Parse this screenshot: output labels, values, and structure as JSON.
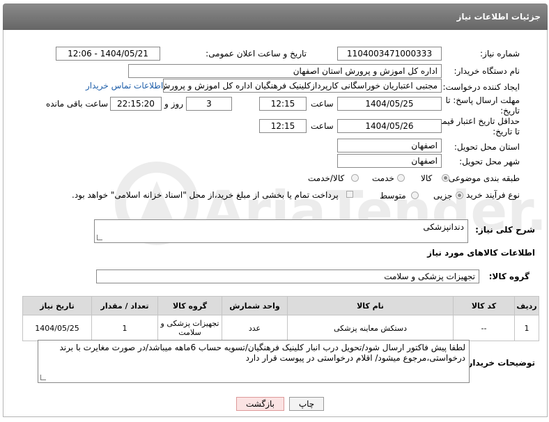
{
  "header": {
    "title": "جزئیات اطلاعات نیاز"
  },
  "form": {
    "need_number_label": "شماره نیاز:",
    "need_number": "1104003471000333",
    "announce_label": "تاریخ و ساعت اعلان عمومی:",
    "announce_value": "1404/05/21 - 12:06",
    "buyer_org_label": "نام دستگاه خریدار:",
    "buyer_org": "اداره کل اموزش و پرورش استان اصفهان",
    "requester_label": "ایجاد کننده درخواست:",
    "requester": "مجتبی اعتباریان خوراسگانی کارپردازکلینیک فرهنگیان اداره کل اموزش و پرورش ا",
    "contact_link": "اطلاعات تماس خریدار",
    "deadline_label_1": "مهلت ارسال پاسخ: تا",
    "deadline_label_2": "تاریخ:",
    "deadline_date": "1404/05/25",
    "time_label": "ساعت",
    "deadline_time": "12:15",
    "days_value": "3",
    "days_label": "روز و",
    "remaining_time": "22:15:20",
    "remaining_label": "ساعت باقی مانده",
    "validity_label_1": "حداقل تاریخ اعتبار قیمت:",
    "validity_label_2": "تا تاریخ:",
    "validity_date": "1404/05/26",
    "validity_time": "12:15",
    "province_label": "استان محل تحویل:",
    "province": "اصفهان",
    "city_label": "شهر محل تحویل:",
    "city": "اصفهان",
    "category_label": "طبقه بندی موضوعی:",
    "category_options": [
      "کالا",
      "خدمت",
      "کالا/خدمت"
    ],
    "process_label": "نوع فرآیند خرید :",
    "process_options": [
      "جزیی",
      "متوسط"
    ],
    "payment_note": "پرداخت تمام یا بخشی از مبلغ خرید،از محل \"اسناد خزانه اسلامی\" خواهد بود."
  },
  "summary": {
    "label": "شرح کلی نیاز:",
    "value": "دندانپزشکی"
  },
  "goods_section": {
    "title": "اطلاعات کالاهای مورد نیاز",
    "group_label": "گروه کالا:",
    "group_value": "تجهیزات پزشکی و سلامت"
  },
  "table": {
    "headers": [
      "ردیف",
      "کد کالا",
      "نام کالا",
      "واحد شمارش",
      "گروه کالا",
      "تعداد / مقدار",
      "تاریخ نیاز"
    ],
    "rows": [
      [
        "1",
        "--",
        "دستکش معاینه پزشکی",
        "عدد",
        "تجهیزات پزشکی و سلامت",
        "1",
        "1404/05/25"
      ]
    ]
  },
  "buyer_notes": {
    "label": "توضیحات خریدار:",
    "value": "لطفا پیش فاکتور ارسال شود/تحویل درب انبار کلینیک فرهنگیان/تسویه حساب 6ماهه میباشد/در صورت مغایرت با برند درخواستی،مرجوع میشود/ اقلام درخواستی در پیوست قرار دارد"
  },
  "buttons": {
    "print": "چاپ",
    "back": "بازگشت"
  },
  "watermark": {
    "text": "AriaTender.net"
  },
  "colors": {
    "title_bg": "#777777",
    "link": "#1f5faa",
    "back_button_bg": "#fbe3e3",
    "print_button_bg": "#f3f3f3"
  }
}
